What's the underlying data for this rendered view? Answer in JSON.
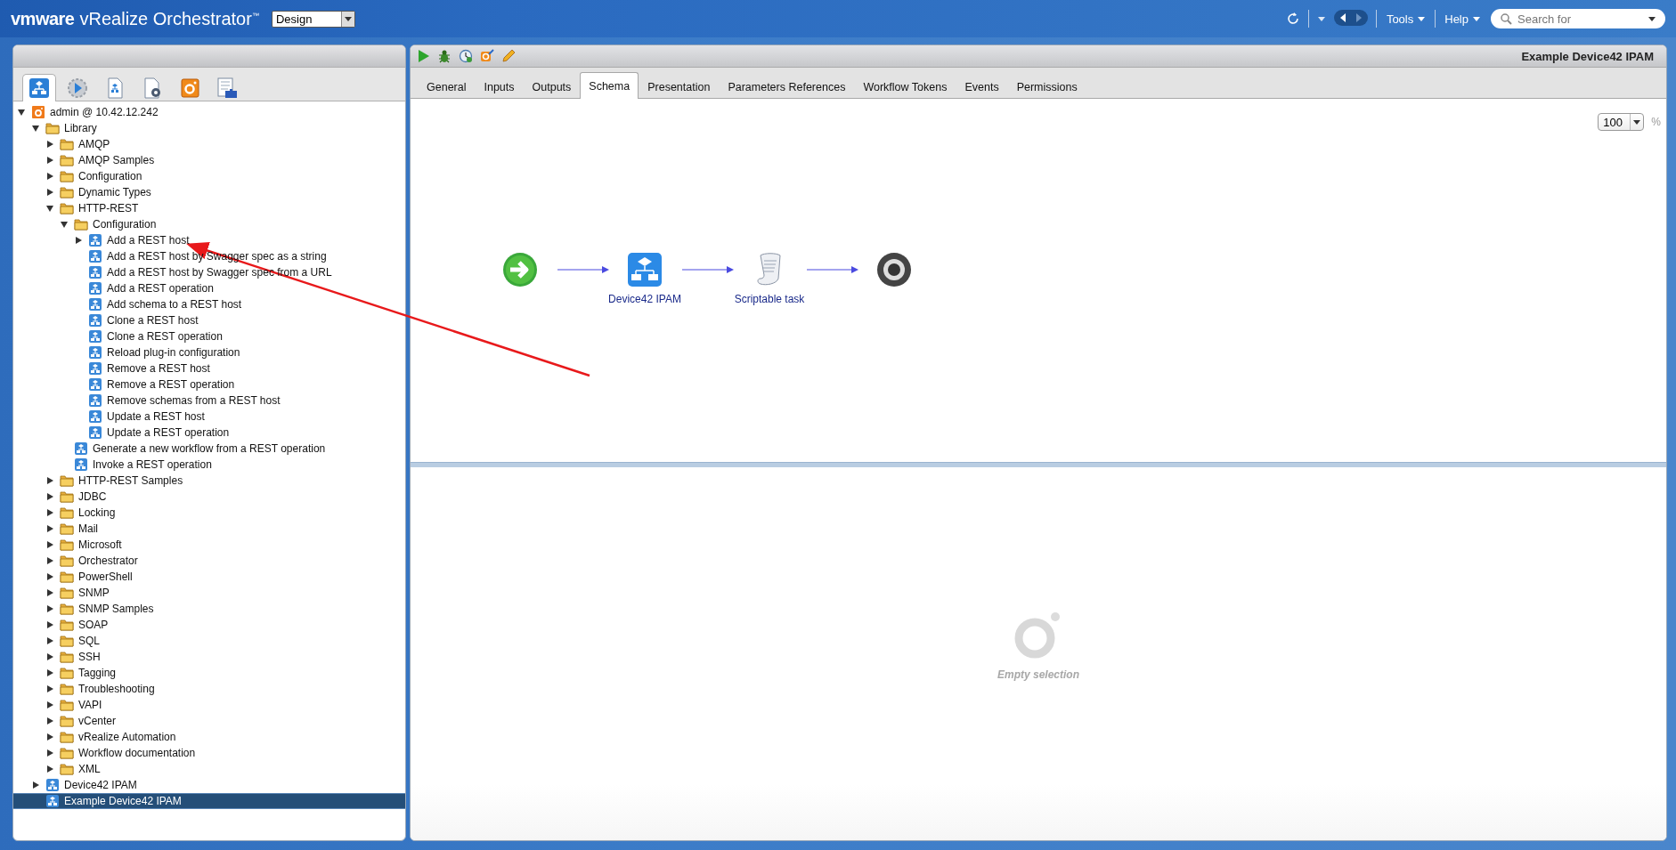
{
  "header": {
    "logo": "vmware",
    "app_title": "vRealize Orchestrator$^{™}$",
    "mode": "Design",
    "menus": [
      {
        "label": "Tools"
      },
      {
        "label": "Help"
      }
    ],
    "search": {
      "placeholder": "Search for"
    }
  },
  "left_tabs": [
    {
      "kind": "workflows",
      "selected": true
    },
    {
      "kind": "runs",
      "selected": false
    },
    {
      "kind": "actions",
      "selected": false
    },
    {
      "kind": "resources",
      "selected": false
    },
    {
      "kind": "inventory",
      "selected": false
    },
    {
      "kind": "packages",
      "selected": false
    }
  ],
  "tree": [
    {
      "label": "admin @ 10.42.12.242",
      "kind": "server",
      "expanded": true,
      "selected": false,
      "children": [
        {
          "label": "Library",
          "kind": "folder",
          "expanded": true,
          "selected": false,
          "children": [
            {
              "label": "AMQP",
              "kind": "folder",
              "expanded": false,
              "selected": false
            },
            {
              "label": "AMQP Samples",
              "kind": "folder",
              "expanded": false,
              "selected": false
            },
            {
              "label": "Configuration",
              "kind": "folder",
              "expanded": false,
              "selected": false
            },
            {
              "label": "Dynamic Types",
              "kind": "folder",
              "expanded": false,
              "selected": false
            },
            {
              "label": "HTTP-REST",
              "kind": "folder",
              "expanded": true,
              "selected": false,
              "children": [
                {
                  "label": "Configuration",
                  "kind": "folder",
                  "expanded": true,
                  "selected": false,
                  "children": [
                    {
                      "label": "Add a REST host",
                      "kind": "workflow",
                      "expanded": false,
                      "selected": false
                    },
                    {
                      "label": "Add a REST host by Swagger spec as a string",
                      "kind": "workflow",
                      "selected": false
                    },
                    {
                      "label": "Add a REST host by Swagger spec from a URL",
                      "kind": "workflow",
                      "selected": false
                    },
                    {
                      "label": "Add a REST operation",
                      "kind": "workflow",
                      "selected": false
                    },
                    {
                      "label": "Add schema to a REST host",
                      "kind": "workflow",
                      "selected": false
                    },
                    {
                      "label": "Clone a REST host",
                      "kind": "workflow",
                      "selected": false
                    },
                    {
                      "label": "Clone a REST operation",
                      "kind": "workflow",
                      "selected": false
                    },
                    {
                      "label": "Reload plug-in configuration",
                      "kind": "workflow",
                      "selected": false
                    },
                    {
                      "label": "Remove a REST host",
                      "kind": "workflow",
                      "selected": false
                    },
                    {
                      "label": "Remove a REST operation",
                      "kind": "workflow",
                      "selected": false
                    },
                    {
                      "label": "Remove schemas from a REST host",
                      "kind": "workflow",
                      "selected": false
                    },
                    {
                      "label": "Update a REST host",
                      "kind": "workflow",
                      "selected": false
                    },
                    {
                      "label": "Update a REST operation",
                      "kind": "workflow",
                      "selected": false
                    }
                  ]
                },
                {
                  "label": "Generate a new workflow from a REST operation",
                  "kind": "workflow",
                  "selected": false
                },
                {
                  "label": "Invoke a REST operation",
                  "kind": "workflow",
                  "selected": false
                }
              ]
            },
            {
              "label": "HTTP-REST Samples",
              "kind": "folder",
              "expanded": false,
              "selected": false
            },
            {
              "label": "JDBC",
              "kind": "folder",
              "expanded": false,
              "selected": false
            },
            {
              "label": "Locking",
              "kind": "folder",
              "expanded": false,
              "selected": false
            },
            {
              "label": "Mail",
              "kind": "folder",
              "expanded": false,
              "selected": false
            },
            {
              "label": "Microsoft",
              "kind": "folder",
              "expanded": false,
              "selected": false
            },
            {
              "label": "Orchestrator",
              "kind": "folder",
              "expanded": false,
              "selected": false
            },
            {
              "label": "PowerShell",
              "kind": "folder",
              "expanded": false,
              "selected": false
            },
            {
              "label": "SNMP",
              "kind": "folder",
              "expanded": false,
              "selected": false
            },
            {
              "label": "SNMP Samples",
              "kind": "folder",
              "expanded": false,
              "selected": false
            },
            {
              "label": "SOAP",
              "kind": "folder",
              "expanded": false,
              "selected": false
            },
            {
              "label": "SQL",
              "kind": "folder",
              "expanded": false,
              "selected": false
            },
            {
              "label": "SSH",
              "kind": "folder",
              "expanded": false,
              "selected": false
            },
            {
              "label": "Tagging",
              "kind": "folder",
              "expanded": false,
              "selected": false
            },
            {
              "label": "Troubleshooting",
              "kind": "folder",
              "expanded": false,
              "selected": false
            },
            {
              "label": "VAPI",
              "kind": "folder",
              "expanded": false,
              "selected": false
            },
            {
              "label": "vCenter",
              "kind": "folder",
              "expanded": false,
              "selected": false
            },
            {
              "label": "vRealize Automation",
              "kind": "folder",
              "expanded": false,
              "selected": false
            },
            {
              "label": "Workflow documentation",
              "kind": "folder",
              "expanded": false,
              "selected": false
            },
            {
              "label": "XML",
              "kind": "folder",
              "expanded": false,
              "selected": false
            }
          ]
        },
        {
          "label": "Device42 IPAM",
          "kind": "workflow",
          "expanded": false,
          "selected": false
        },
        {
          "label": "Example Device42 IPAM",
          "kind": "workflow",
          "selected": true
        }
      ]
    }
  ],
  "editor": {
    "title": "Example Device42 IPAM",
    "tabs": [
      {
        "label": "General",
        "selected": false
      },
      {
        "label": "Inputs",
        "selected": false
      },
      {
        "label": "Outputs",
        "selected": false
      },
      {
        "label": "Schema",
        "selected": true
      },
      {
        "label": "Presentation",
        "selected": false
      },
      {
        "label": "Parameters References",
        "selected": false
      },
      {
        "label": "Workflow Tokens",
        "selected": false
      },
      {
        "label": "Events",
        "selected": false
      },
      {
        "label": "Permissions",
        "selected": false
      }
    ],
    "zoom": {
      "value": "100",
      "unit": "%"
    },
    "nodes": [
      {
        "kind": "start"
      },
      {
        "kind": "workflow",
        "label": "Device42 IPAM"
      },
      {
        "kind": "script",
        "label": "Scriptable task"
      },
      {
        "kind": "end"
      }
    ],
    "empty_message": "Empty selection"
  }
}
